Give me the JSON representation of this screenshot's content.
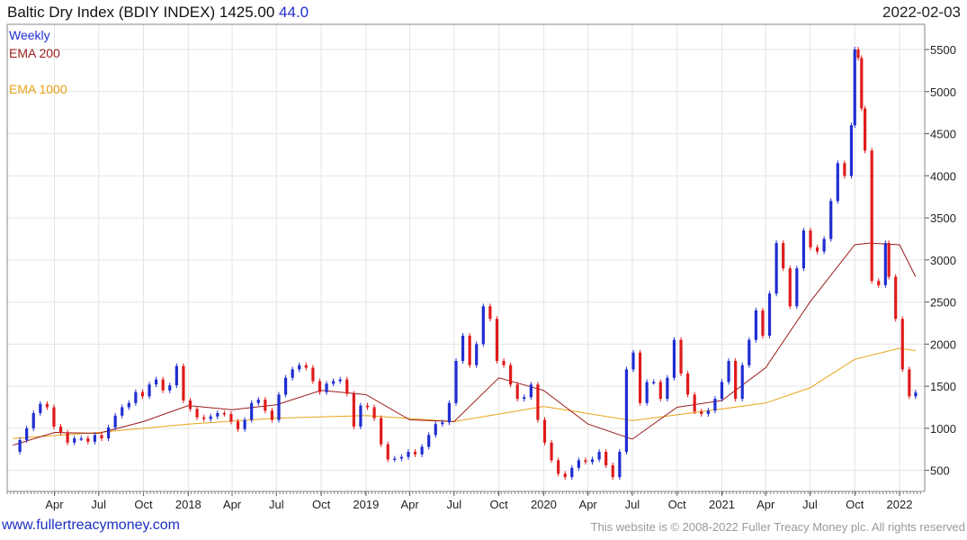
{
  "header": {
    "title": "Baltic Dry Index (BDIY INDEX) 1425.00",
    "change": "44.0",
    "date": "2022-02-03"
  },
  "legend": [
    {
      "label": "Weekly",
      "color": "#1f2dd1"
    },
    {
      "label": "EMA 200",
      "color": "#9b1c1c"
    },
    {
      "label": "EMA 1000",
      "color": "#e8a317"
    }
  ],
  "footer": {
    "website": "www.fullertreacymoney.com",
    "copyright": "This website is © 2008-2022 Fuller Treacy Money plc. All rights reserved"
  },
  "colors": {
    "up": "#1f2dd1",
    "down": "#e01b1b",
    "ema200": "#9b1c1c",
    "ema1000": "#e8a317",
    "grid": "#e4e4e4"
  },
  "chart_data": {
    "type": "candlestick",
    "frequency": "weekly",
    "ylim": [
      250,
      5800
    ],
    "y_ticks": [
      500,
      1000,
      1500,
      2000,
      2500,
      3000,
      3500,
      4000,
      4500,
      5000,
      5500
    ],
    "x_ticks": [
      {
        "label": "Apr",
        "date": "2017-04-01"
      },
      {
        "label": "Jul",
        "date": "2017-07-01"
      },
      {
        "label": "Oct",
        "date": "2017-10-01"
      },
      {
        "label": "2018",
        "date": "2018-01-01"
      },
      {
        "label": "Apr",
        "date": "2018-04-01"
      },
      {
        "label": "Jul",
        "date": "2018-07-01"
      },
      {
        "label": "Oct",
        "date": "2018-10-01"
      },
      {
        "label": "2019",
        "date": "2019-01-01"
      },
      {
        "label": "Apr",
        "date": "2019-04-01"
      },
      {
        "label": "Jul",
        "date": "2019-07-01"
      },
      {
        "label": "Oct",
        "date": "2019-10-01"
      },
      {
        "label": "2020",
        "date": "2020-01-01"
      },
      {
        "label": "Apr",
        "date": "2020-04-01"
      },
      {
        "label": "Jul",
        "date": "2020-07-01"
      },
      {
        "label": "Oct",
        "date": "2020-10-01"
      },
      {
        "label": "2021",
        "date": "2021-01-01"
      },
      {
        "label": "Apr",
        "date": "2021-04-01"
      },
      {
        "label": "Jul",
        "date": "2021-07-01"
      },
      {
        "label": "Oct",
        "date": "2021-10-01"
      },
      {
        "label": "2022",
        "date": "2022-01-01"
      }
    ],
    "weekly_close": [
      [
        "2017-01-06",
        720
      ],
      [
        "2017-01-20",
        860
      ],
      [
        "2017-02-03",
        1000
      ],
      [
        "2017-02-17",
        1180
      ],
      [
        "2017-03-03",
        1290
      ],
      [
        "2017-03-17",
        1250
      ],
      [
        "2017-03-31",
        1020
      ],
      [
        "2017-04-14",
        950
      ],
      [
        "2017-04-28",
        830
      ],
      [
        "2017-05-12",
        880
      ],
      [
        "2017-05-26",
        880
      ],
      [
        "2017-06-09",
        840
      ],
      [
        "2017-06-23",
        920
      ],
      [
        "2017-07-07",
        880
      ],
      [
        "2017-07-21",
        1010
      ],
      [
        "2017-08-04",
        1150
      ],
      [
        "2017-08-18",
        1250
      ],
      [
        "2017-09-01",
        1300
      ],
      [
        "2017-09-15",
        1430
      ],
      [
        "2017-09-29",
        1380
      ],
      [
        "2017-10-13",
        1520
      ],
      [
        "2017-10-27",
        1580
      ],
      [
        "2017-11-10",
        1450
      ],
      [
        "2017-11-24",
        1510
      ],
      [
        "2017-12-08",
        1740
      ],
      [
        "2017-12-22",
        1330
      ],
      [
        "2018-01-05",
        1230
      ],
      [
        "2018-01-19",
        1130
      ],
      [
        "2018-02-02",
        1110
      ],
      [
        "2018-02-16",
        1140
      ],
      [
        "2018-03-02",
        1180
      ],
      [
        "2018-03-16",
        1170
      ],
      [
        "2018-03-30",
        1080
      ],
      [
        "2018-04-13",
        990
      ],
      [
        "2018-04-27",
        1100
      ],
      [
        "2018-05-11",
        1300
      ],
      [
        "2018-05-25",
        1340
      ],
      [
        "2018-06-08",
        1210
      ],
      [
        "2018-06-22",
        1100
      ],
      [
        "2018-07-06",
        1400
      ],
      [
        "2018-07-20",
        1600
      ],
      [
        "2018-08-03",
        1700
      ],
      [
        "2018-08-17",
        1750
      ],
      [
        "2018-08-31",
        1720
      ],
      [
        "2018-09-14",
        1560
      ],
      [
        "2018-09-28",
        1430
      ],
      [
        "2018-10-12",
        1530
      ],
      [
        "2018-10-26",
        1560
      ],
      [
        "2018-11-09",
        1580
      ],
      [
        "2018-11-23",
        1410
      ],
      [
        "2018-12-07",
        1020
      ],
      [
        "2018-12-21",
        1270
      ],
      [
        "2019-01-04",
        1250
      ],
      [
        "2019-01-18",
        1120
      ],
      [
        "2019-02-01",
        810
      ],
      [
        "2019-02-15",
        630
      ],
      [
        "2019-03-01",
        640
      ],
      [
        "2019-03-15",
        660
      ],
      [
        "2019-03-29",
        720
      ],
      [
        "2019-04-12",
        690
      ],
      [
        "2019-04-26",
        780
      ],
      [
        "2019-05-10",
        920
      ],
      [
        "2019-05-24",
        1050
      ],
      [
        "2019-06-07",
        1070
      ],
      [
        "2019-06-21",
        1300
      ],
      [
        "2019-07-05",
        1800
      ],
      [
        "2019-07-19",
        2100
      ],
      [
        "2019-08-02",
        1750
      ],
      [
        "2019-08-16",
        2000
      ],
      [
        "2019-08-30",
        2450
      ],
      [
        "2019-09-13",
        2300
      ],
      [
        "2019-09-27",
        1800
      ],
      [
        "2019-10-11",
        1750
      ],
      [
        "2019-10-25",
        1520
      ],
      [
        "2019-11-08",
        1350
      ],
      [
        "2019-11-22",
        1370
      ],
      [
        "2019-12-06",
        1520
      ],
      [
        "2019-12-20",
        1100
      ],
      [
        "2020-01-03",
        830
      ],
      [
        "2020-01-17",
        620
      ],
      [
        "2020-01-31",
        460
      ],
      [
        "2020-02-14",
        420
      ],
      [
        "2020-02-28",
        530
      ],
      [
        "2020-03-13",
        620
      ],
      [
        "2020-03-27",
        600
      ],
      [
        "2020-04-10",
        630
      ],
      [
        "2020-04-24",
        720
      ],
      [
        "2020-05-08",
        560
      ],
      [
        "2020-05-22",
        420
      ],
      [
        "2020-06-05",
        720
      ],
      [
        "2020-06-19",
        1700
      ],
      [
        "2020-07-03",
        1900
      ],
      [
        "2020-07-17",
        1300
      ],
      [
        "2020-07-31",
        1550
      ],
      [
        "2020-08-14",
        1550
      ],
      [
        "2020-08-28",
        1350
      ],
      [
        "2020-09-11",
        1600
      ],
      [
        "2020-09-25",
        2050
      ],
      [
        "2020-10-09",
        1650
      ],
      [
        "2020-10-23",
        1400
      ],
      [
        "2020-11-06",
        1200
      ],
      [
        "2020-11-20",
        1170
      ],
      [
        "2020-12-04",
        1210
      ],
      [
        "2020-12-18",
        1350
      ],
      [
        "2021-01-01",
        1550
      ],
      [
        "2021-01-15",
        1800
      ],
      [
        "2021-01-29",
        1350
      ],
      [
        "2021-02-12",
        1750
      ],
      [
        "2021-02-26",
        2050
      ],
      [
        "2021-03-12",
        2400
      ],
      [
        "2021-03-26",
        2100
      ],
      [
        "2021-04-09",
        2600
      ],
      [
        "2021-04-23",
        3200
      ],
      [
        "2021-05-07",
        2900
      ],
      [
        "2021-05-21",
        2450
      ],
      [
        "2021-06-04",
        2900
      ],
      [
        "2021-06-18",
        3350
      ],
      [
        "2021-07-02",
        3150
      ],
      [
        "2021-07-16",
        3100
      ],
      [
        "2021-07-30",
        3250
      ],
      [
        "2021-08-13",
        3700
      ],
      [
        "2021-08-27",
        4150
      ],
      [
        "2021-09-10",
        4000
      ],
      [
        "2021-09-24",
        4600
      ],
      [
        "2021-10-01",
        5500
      ],
      [
        "2021-10-08",
        5400
      ],
      [
        "2021-10-15",
        4800
      ],
      [
        "2021-10-22",
        4300
      ],
      [
        "2021-11-05",
        2750
      ],
      [
        "2021-11-19",
        2700
      ],
      [
        "2021-12-03",
        3200
      ],
      [
        "2021-12-10",
        2800
      ],
      [
        "2021-12-24",
        2300
      ],
      [
        "2022-01-07",
        1700
      ],
      [
        "2022-01-21",
        1380
      ],
      [
        "2022-02-03",
        1425
      ]
    ],
    "ema200": [
      [
        "2017-01-06",
        800
      ],
      [
        "2017-04-01",
        950
      ],
      [
        "2017-07-01",
        940
      ],
      [
        "2017-10-01",
        1080
      ],
      [
        "2018-01-01",
        1270
      ],
      [
        "2018-04-01",
        1220
      ],
      [
        "2018-07-01",
        1280
      ],
      [
        "2018-10-01",
        1450
      ],
      [
        "2019-01-01",
        1400
      ],
      [
        "2019-04-01",
        1100
      ],
      [
        "2019-07-01",
        1080
      ],
      [
        "2019-10-01",
        1600
      ],
      [
        "2020-01-01",
        1450
      ],
      [
        "2020-04-01",
        1050
      ],
      [
        "2020-07-01",
        870
      ],
      [
        "2020-10-01",
        1250
      ],
      [
        "2021-01-01",
        1330
      ],
      [
        "2021-04-01",
        1720
      ],
      [
        "2021-07-01",
        2500
      ],
      [
        "2021-10-01",
        3180
      ],
      [
        "2021-11-01",
        3200
      ],
      [
        "2022-01-01",
        3180
      ],
      [
        "2022-02-03",
        2800
      ]
    ],
    "ema1000": [
      [
        "2017-01-06",
        880
      ],
      [
        "2017-07-01",
        950
      ],
      [
        "2018-01-01",
        1050
      ],
      [
        "2018-07-01",
        1120
      ],
      [
        "2019-01-01",
        1150
      ],
      [
        "2019-07-01",
        1080
      ],
      [
        "2020-01-01",
        1260
      ],
      [
        "2020-07-01",
        1090
      ],
      [
        "2021-01-01",
        1230
      ],
      [
        "2021-04-01",
        1300
      ],
      [
        "2021-07-01",
        1480
      ],
      [
        "2021-10-01",
        1820
      ],
      [
        "2022-01-01",
        1950
      ],
      [
        "2022-02-03",
        1920
      ]
    ]
  }
}
